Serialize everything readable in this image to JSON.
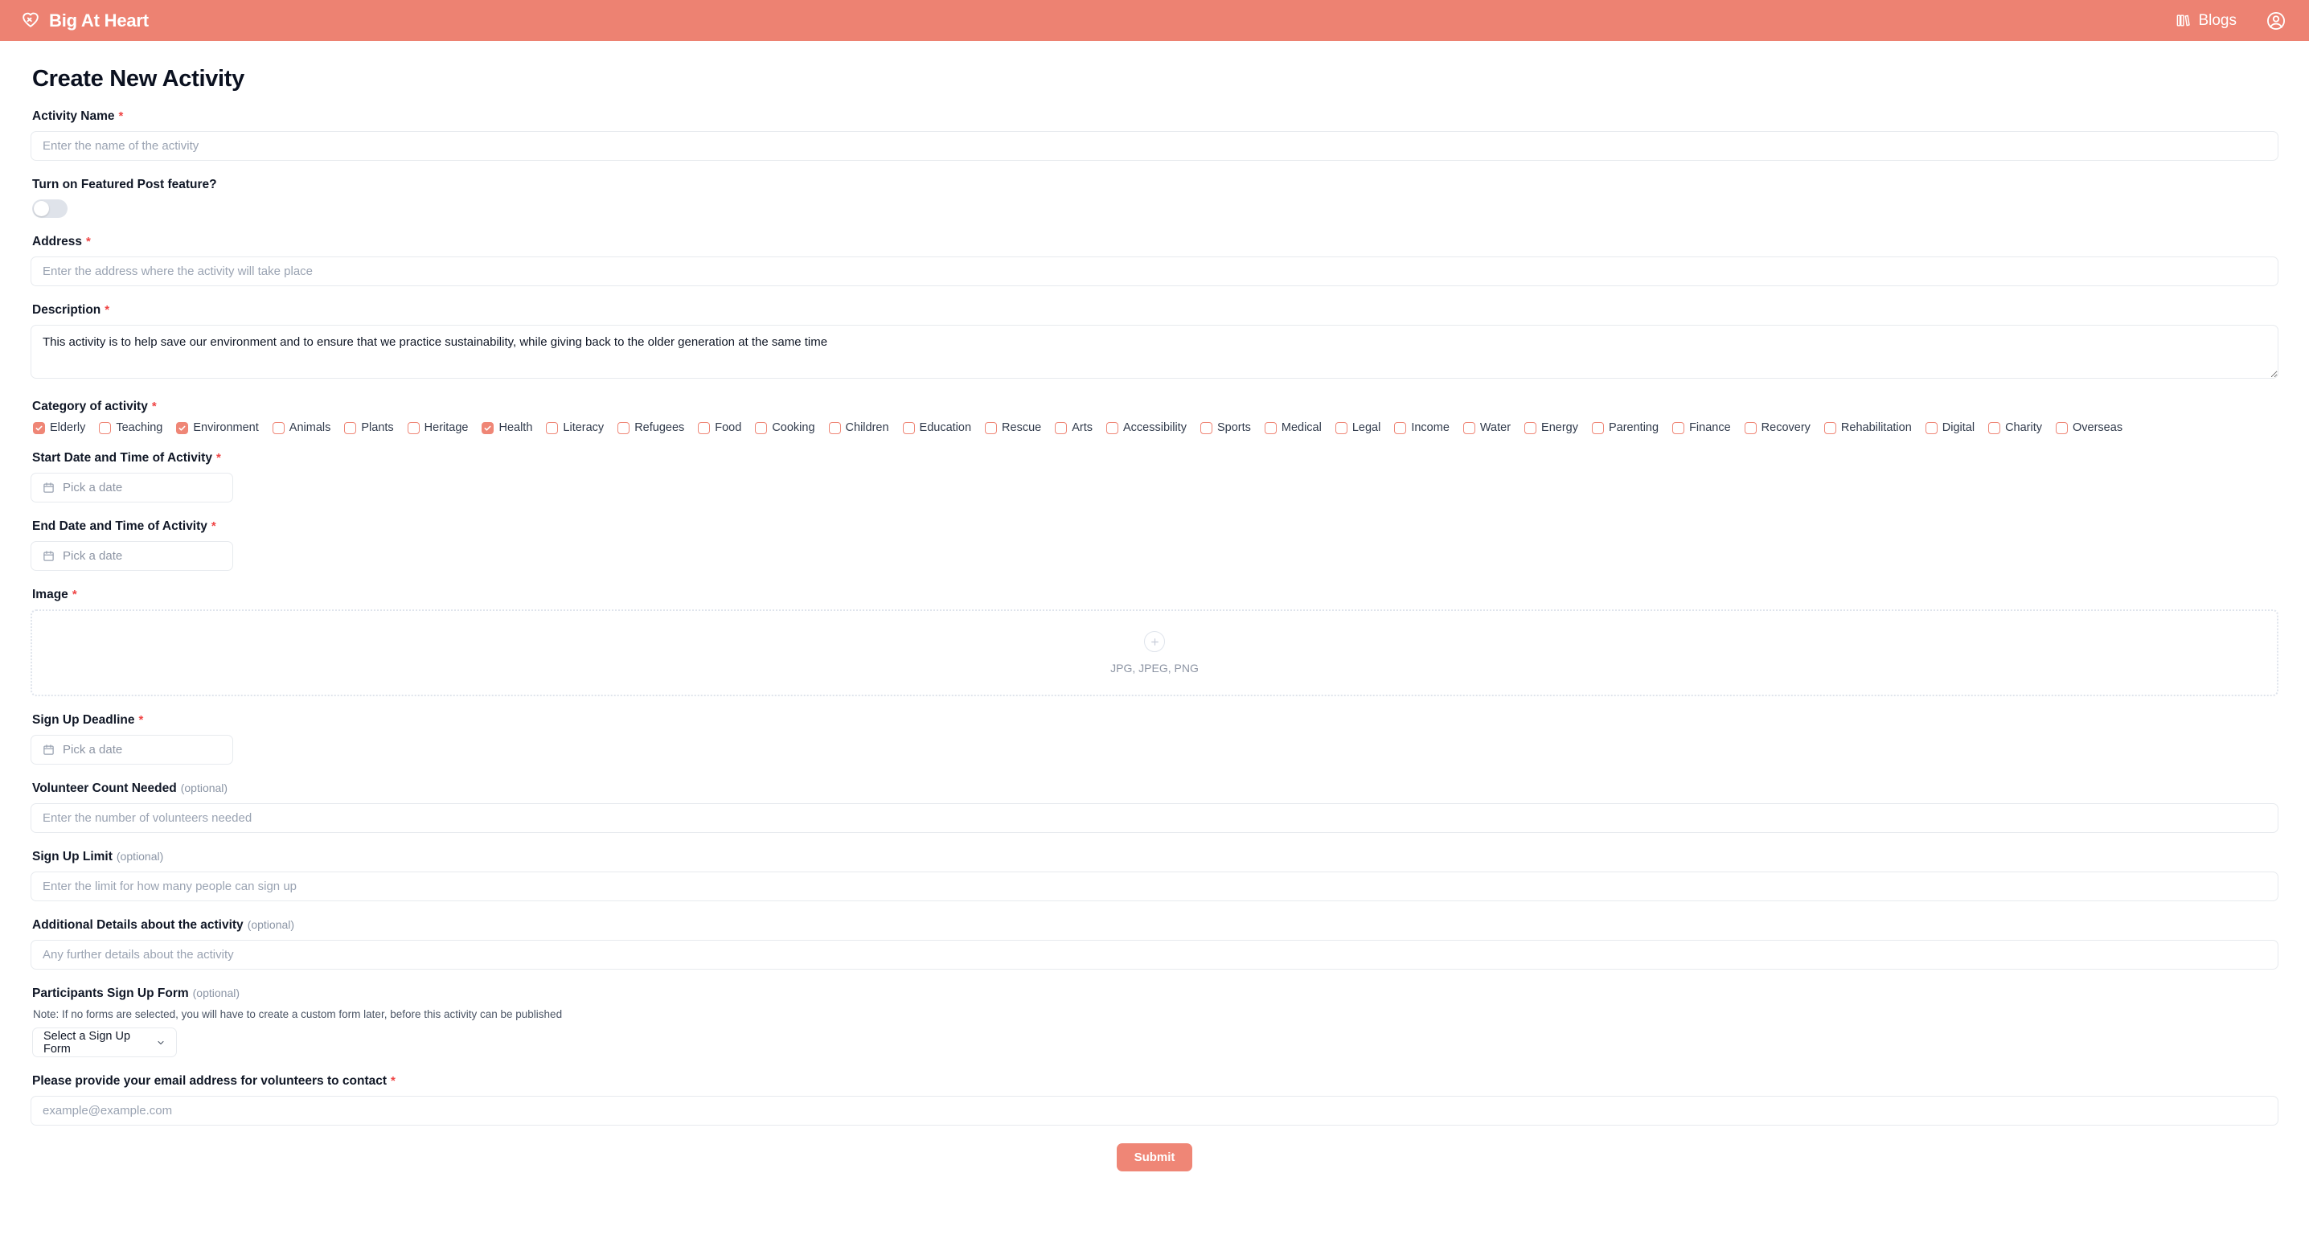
{
  "navbar": {
    "brand": "Big At Heart",
    "brand_icon": "heart-icon",
    "blogs_label": "Blogs",
    "blogs_icon": "books-icon",
    "account_icon": "user-circle-icon",
    "background_color": "#ed8272"
  },
  "page": {
    "title": "Create New Activity",
    "accent_color": "#ef8676",
    "required_marker": "*",
    "optional_marker": "(optional)"
  },
  "fields": {
    "activity_name": {
      "label": "Activity Name",
      "placeholder": "Enter the name of the activity",
      "value": "",
      "required": true
    },
    "featured_post": {
      "label": "Turn on Featured Post feature?",
      "state": "off"
    },
    "address": {
      "label": "Address",
      "placeholder": "Enter the address where the activity will take place",
      "value": "",
      "required": true
    },
    "description": {
      "label": "Description",
      "value": "This activity is to help save our environment and to ensure that we practice sustainability, while giving back to the older generation at the same time",
      "required": true
    },
    "category": {
      "label": "Category of activity",
      "required": true,
      "options": [
        {
          "label": "Elderly",
          "checked": true
        },
        {
          "label": "Teaching",
          "checked": false
        },
        {
          "label": "Environment",
          "checked": true
        },
        {
          "label": "Animals",
          "checked": false
        },
        {
          "label": "Plants",
          "checked": false
        },
        {
          "label": "Heritage",
          "checked": false
        },
        {
          "label": "Health",
          "checked": true
        },
        {
          "label": "Literacy",
          "checked": false
        },
        {
          "label": "Refugees",
          "checked": false
        },
        {
          "label": "Food",
          "checked": false
        },
        {
          "label": "Cooking",
          "checked": false
        },
        {
          "label": "Children",
          "checked": false
        },
        {
          "label": "Education",
          "checked": false
        },
        {
          "label": "Rescue",
          "checked": false
        },
        {
          "label": "Arts",
          "checked": false
        },
        {
          "label": "Accessibility",
          "checked": false
        },
        {
          "label": "Sports",
          "checked": false
        },
        {
          "label": "Medical",
          "checked": false
        },
        {
          "label": "Legal",
          "checked": false
        },
        {
          "label": "Income",
          "checked": false
        },
        {
          "label": "Water",
          "checked": false
        },
        {
          "label": "Energy",
          "checked": false
        },
        {
          "label": "Parenting",
          "checked": false
        },
        {
          "label": "Finance",
          "checked": false
        },
        {
          "label": "Recovery",
          "checked": false
        },
        {
          "label": "Rehabilitation",
          "checked": false
        },
        {
          "label": "Digital",
          "checked": false
        },
        {
          "label": "Charity",
          "checked": false
        },
        {
          "label": "Overseas",
          "checked": false
        }
      ]
    },
    "start_date": {
      "label": "Start Date and Time of Activity",
      "value": "Pick a date",
      "icon": "calendar-icon",
      "required": true
    },
    "end_date": {
      "label": "End Date and Time of Activity",
      "value": "Pick a date",
      "icon": "calendar-icon",
      "required": true
    },
    "image": {
      "label": "Image",
      "required": true,
      "upload_icon": "plus-circle-icon",
      "formats": "JPG, JPEG, PNG"
    },
    "signup_deadline": {
      "label": "Sign Up Deadline",
      "value": "Pick a date",
      "icon": "calendar-icon",
      "required": true
    },
    "volunteer_count": {
      "label": "Volunteer Count Needed",
      "placeholder": "Enter the number of volunteers needed",
      "value": "",
      "optional": true
    },
    "signup_limit": {
      "label": "Sign Up Limit",
      "placeholder": "Enter the limit for how many people can sign up",
      "value": "",
      "optional": true
    },
    "additional_details": {
      "label": "Additional Details about the activity",
      "placeholder": "Any further details about the activity",
      "value": "",
      "optional": true
    },
    "signup_form": {
      "label": "Participants Sign Up Form",
      "optional": true,
      "note": "Note: If no forms are selected, you will have to create a custom form later, before this activity can be published",
      "selected": "Select a Sign Up Form",
      "chevron_icon": "chevron-down-icon"
    },
    "contact_email": {
      "label": "Please provide your email address for volunteers to contact",
      "placeholder": "example@example.com",
      "value": "",
      "required": true
    }
  },
  "submit": {
    "label": "Submit"
  }
}
